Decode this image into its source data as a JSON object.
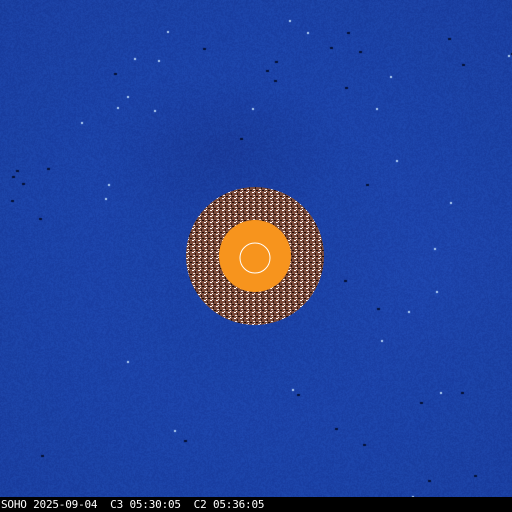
{
  "image": {
    "caption": "SOHO 2025-09-04  C3 05:30:05  C2 05:36:05",
    "colors": {
      "background_blue": "#1d44aa",
      "occulter_orange": "#f7941d",
      "sun_outline": "#ffffff",
      "caption_bar": "#000000",
      "caption_text": "#ffffff"
    }
  }
}
